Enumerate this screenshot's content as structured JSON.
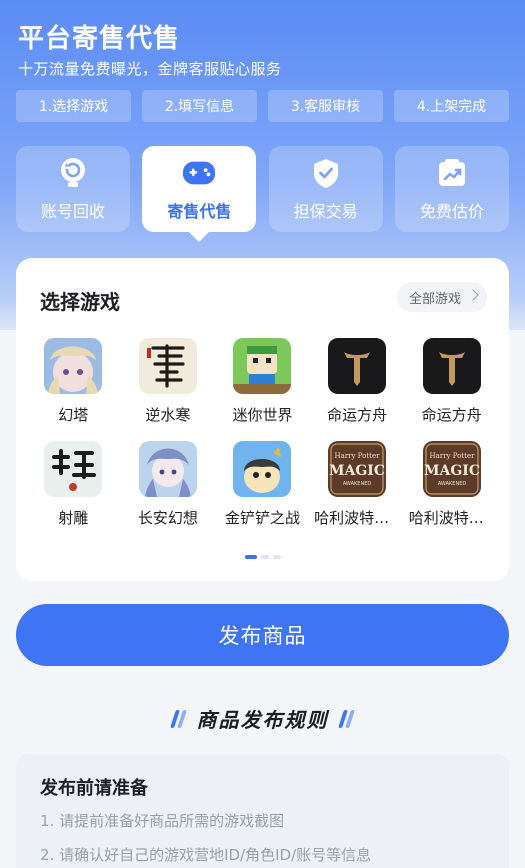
{
  "header": {
    "title": "平台寄售代售",
    "subtitle": "十万流量免费曝光，金牌客服贴心服务"
  },
  "steps": [
    "1.选择游戏",
    "2.填写信息",
    "3.客服审核",
    "4.上架完成"
  ],
  "services": [
    {
      "label": "账号回收",
      "icon": "recycle-icon"
    },
    {
      "label": "寄售代售",
      "icon": "gamepad-icon",
      "active": true
    },
    {
      "label": "担保交易",
      "icon": "shield-check-icon"
    },
    {
      "label": "免费估价",
      "icon": "trend-chart-icon"
    }
  ],
  "game_card": {
    "title": "选择游戏",
    "all_games_label": "全部游戏",
    "games": [
      {
        "name": "幻塔",
        "icon": "game-icon-huanta",
        "color": "#e7d3e6"
      },
      {
        "name": "逆水寒",
        "icon": "game-icon-nishuihan",
        "color": "#f0ead8"
      },
      {
        "name": "迷你世界",
        "icon": "game-icon-mini-world",
        "color": "#8fd16b"
      },
      {
        "name": "命运方舟",
        "icon": "game-icon-lost-ark",
        "color": "#1b1b1d"
      },
      {
        "name": "命运方舟",
        "icon": "game-icon-lost-ark",
        "color": "#1b1b1d"
      },
      {
        "name": "射雕",
        "icon": "game-icon-shediao",
        "color": "#eef2f0"
      },
      {
        "name": "长安幻想",
        "icon": "game-icon-changan",
        "color": "#a8c4e6"
      },
      {
        "name": "金铲铲之战",
        "icon": "game-icon-jinchanchan",
        "color": "#7ab8f0"
      },
      {
        "name": "哈利波特：魔法觉醒",
        "icon": "game-icon-harry-potter",
        "color": "#5a3a2a"
      },
      {
        "name": "哈利波特：魔法觉醒",
        "icon": "game-icon-harry-potter",
        "color": "#5a3a2a"
      }
    ],
    "hp_logo": {
      "line1": "Harry Potter",
      "line2": "MAGIC",
      "line3": "AWAKENED"
    },
    "pagination": {
      "pages": 3,
      "active": 1
    }
  },
  "publish_button": "发布商品",
  "rules": {
    "title": "商品发布规则",
    "prep_title": "发布前请准备",
    "items": [
      "1.  请提前准备好商品所需的游戏截图",
      "2.  请确认好自己的游戏营地ID/角色ID/账号等信息"
    ]
  },
  "colors": {
    "primary": "#3f74f4",
    "hero_top": "#5a8cf6"
  }
}
